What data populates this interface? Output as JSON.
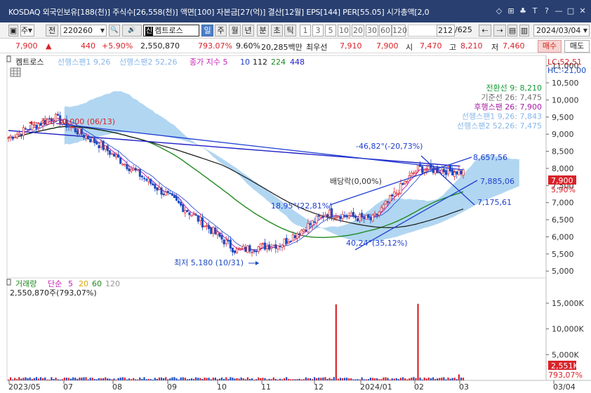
{
  "window": {
    "title": "KOSDAQ 외국인보유[188(천)] 주식수[26,558(천)] 액면[100] 자본금[27(억)] 결산[12월] EPS[144] PER[55.05] 시가총액[2,0",
    "buttons": [
      "◇",
      "⊞",
      "♣",
      "T",
      "?",
      "—",
      "□",
      "✕"
    ]
  },
  "toolbar": {
    "market": "주",
    "prev": "전",
    "code": "220260",
    "search_icon": "🔍",
    "sound_icon": "🔊",
    "sin": "신",
    "name": "켐트로스",
    "periods": [
      "일",
      "주",
      "월",
      "년",
      "분",
      "초",
      "틱"
    ],
    "selected_period": "일",
    "intervals": [
      "1",
      "3",
      "5",
      "10",
      "20",
      "30",
      "60",
      "120"
    ],
    "count": "212",
    "total": "/625",
    "date": "2024/03/04"
  },
  "quote": {
    "price": "7,900",
    "change_sign": "▲",
    "change": "440",
    "change_rate": "+5.90%",
    "volume": "2,550,870",
    "volume_ratio": "793.07%",
    "turnover": "9.60%",
    "amount": "20,285백만",
    "best_label": "최우선",
    "best_ask": "7,910",
    "best_bid": "7,900",
    "open_label": "시",
    "open": "7,470",
    "high_label": "고",
    "high": "8,210",
    "low_label": "저",
    "low": "7,460",
    "buy": "매수",
    "sell": "매도"
  },
  "chart_legend": {
    "name": "켐트로스",
    "span1": "선행스팬1 9,26",
    "span2": "선행스팬2 52,26",
    "ma_label": "종가 지수 5",
    "ma": [
      "10",
      "112",
      "224",
      "448"
    ],
    "lc": "LC:52,51",
    "hc": "HC:-21,00"
  },
  "ichimoku_values": [
    {
      "text": "전환선 9: 8,210",
      "color": "#139b33"
    },
    {
      "text": "기준선 26: 7,475",
      "color": "#6d6d6d"
    },
    {
      "text": "후행스팬 26: 7,900",
      "color": "#a31fa3"
    },
    {
      "text": "선행스팬1 9,26: 7,843",
      "color": "#88b7e8"
    },
    {
      "text": "선행스팬2 52,26: 7,475",
      "color": "#88b7e8"
    }
  ],
  "annotations": {
    "high": "최고 10,000 (06/13)",
    "low": "최저 5,180 (10/31)",
    "ex_dividend": "배당락(0,00%)",
    "angle1": "-46,82°(-20,73%)",
    "angle2": "18,95°(22,81%)",
    "angle3": "40,24°(35,12%)",
    "level1": "8,657,56",
    "level2": "7,885,06",
    "level3": "7,175,61"
  },
  "price_axis": {
    "ticks": [
      "11,000",
      "10,500",
      "10,000",
      "9,500",
      "9,000",
      "8,500",
      "8,000",
      "7,500",
      "7,000",
      "6,500",
      "6,000",
      "5,500",
      "5,000"
    ],
    "current": "7,900",
    "current_rate": "5,90%",
    "colors": {
      "up": "#d8232a",
      "down": "#1f4cc0",
      "ma5": "#c81fb6",
      "ma10": "#1f3fd0",
      "ma112": "#1a1a1a",
      "ma224": "#1f8a1f",
      "ma448": "#1f1fc8",
      "cloud": "#a9d1f0"
    }
  },
  "volume_legend": {
    "name": "거래량",
    "ma_label": "단순",
    "ma": [
      "5",
      "20",
      "60",
      "120"
    ],
    "value": "2,550,870주(793,07%)"
  },
  "volume_axis": {
    "ticks": [
      "15,000K",
      "10,000K",
      "5,000K"
    ],
    "current": "2,551K",
    "rate": "793,07%"
  },
  "x_axis": [
    "2023/05",
    "07",
    "08",
    "09",
    "10",
    "11",
    "12",
    "2024/01",
    "02",
    "03",
    "03/04"
  ],
  "chart_data": {
    "type": "candlestick",
    "symbol": "220260",
    "name": "켐트로스",
    "start": "2023/05",
    "end": "2024/03/04",
    "price_axis": {
      "min": 4800,
      "max": 11300,
      "ticks": [
        11000,
        10500,
        10000,
        9500,
        9000,
        8500,
        8000,
        7500,
        7000,
        6500,
        6000,
        5500,
        5000
      ]
    },
    "volume_axis": {
      "min": 0,
      "max": 18000,
      "unit": "K",
      "ticks": [
        15000,
        10000,
        5000
      ]
    },
    "key_points": [
      {
        "label": "최고",
        "date": "06/13",
        "price": 10000
      },
      {
        "label": "최저",
        "date": "10/31",
        "price": 5180
      },
      {
        "label": "종가",
        "date": "03/04",
        "price": 7900
      }
    ],
    "close_trend": [
      {
        "month": "2023/05",
        "price": 8900
      },
      {
        "month": "2023/06",
        "price": 9500
      },
      {
        "month": "2023/07",
        "price": 8700
      },
      {
        "month": "2023/08",
        "price": 7700
      },
      {
        "month": "2023/09",
        "price": 6700
      },
      {
        "month": "2023/10",
        "price": 5600
      },
      {
        "month": "2023/11",
        "price": 5800
      },
      {
        "month": "2023/12",
        "price": 6700
      },
      {
        "month": "2024/01",
        "price": 6500
      },
      {
        "month": "2024/02",
        "price": 8000
      },
      {
        "month": "2024/03",
        "price": 7900
      }
    ],
    "volume_spikes_K": [
      {
        "month": "2023/12",
        "value": 15200
      },
      {
        "month": "2024/02",
        "value": 17600
      },
      {
        "month": "2024/03",
        "value": 2551
      }
    ]
  }
}
